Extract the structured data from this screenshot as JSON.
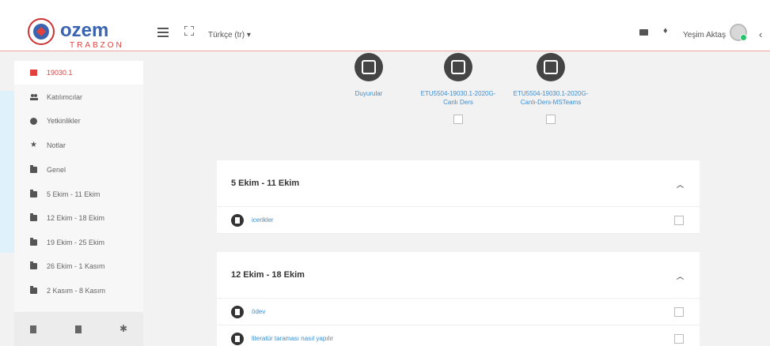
{
  "header": {
    "logo_text": "ozem",
    "logo_subtext": "TRABZON",
    "language": "Türkçe (tr) ▾",
    "user_name": "Yeşim Aktaş"
  },
  "sidebar": {
    "items": [
      {
        "label": "19030.1",
        "icon": "course-icon",
        "active": true
      },
      {
        "label": "Katılımcılar",
        "icon": "users-icon"
      },
      {
        "label": "Yetkinlikler",
        "icon": "check-circle-icon"
      },
      {
        "label": "Notlar",
        "icon": "star-icon"
      },
      {
        "label": "Genel",
        "icon": "folder-icon"
      },
      {
        "label": "5 Ekim - 11 Ekim",
        "icon": "folder-icon"
      },
      {
        "label": "12 Ekim - 18 Ekim",
        "icon": "folder-icon"
      },
      {
        "label": "19 Ekim - 25 Ekim",
        "icon": "folder-icon"
      },
      {
        "label": "26 Ekim - 1 Kasım",
        "icon": "folder-icon"
      },
      {
        "label": "2 Kasım - 8 Kasım",
        "icon": "folder-icon"
      }
    ]
  },
  "activities": [
    {
      "label": "Duyurular",
      "icon": "forum-icon"
    },
    {
      "label_line1": "ETU5504-19030.1-2020G-",
      "label_line2": "Canlı Ders",
      "icon": "presentation-icon"
    },
    {
      "label_line1": "ETU5504-19030.1-2020G-",
      "label_line2": "Canlı-Ders-MSTeams",
      "icon": "laptop-icon"
    }
  ],
  "sections": [
    {
      "title": "5 Ekim - 11 Ekim",
      "items": [
        "icerikler"
      ]
    },
    {
      "title": "12 Ekim - 18 Ekim",
      "items": [
        "ödev",
        "literatür taraması nasıl yapılır"
      ]
    }
  ],
  "colors": {
    "accent": "#e2423e",
    "link": "#3e8ed0"
  }
}
